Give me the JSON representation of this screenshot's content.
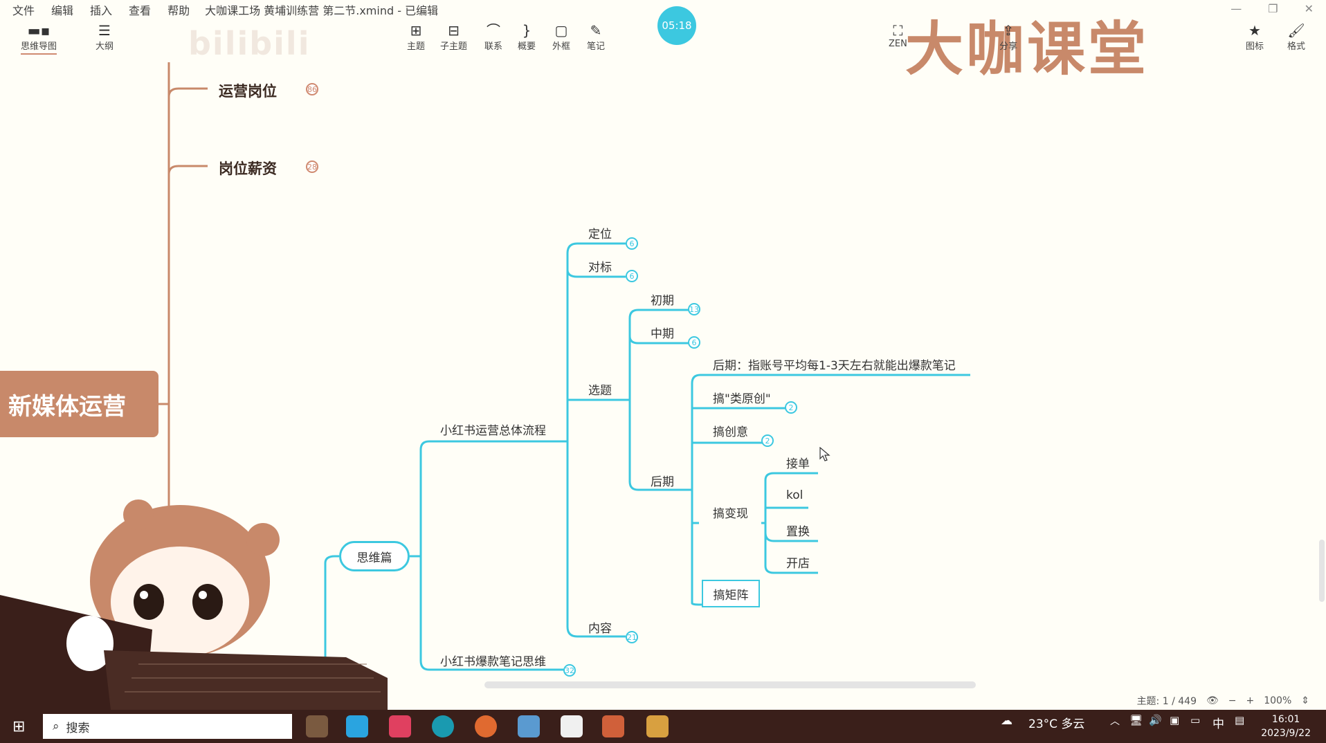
{
  "menu": [
    "文件",
    "编辑",
    "插入",
    "查看",
    "帮助"
  ],
  "window_title": "大咖课工场 黄埔训练营 第二节.xmind - 已编辑",
  "timer": "05:18",
  "brand": "大咖课堂",
  "toolbar": {
    "left": [
      {
        "label": "思维导图",
        "icon": "mindmap-icon"
      },
      {
        "label": "大纲",
        "icon": "outline-icon"
      }
    ],
    "center": [
      {
        "label": "主题",
        "icon": "topic-icon"
      },
      {
        "label": "子主题",
        "icon": "subtopic-icon"
      },
      {
        "label": "联系",
        "icon": "relationship-icon"
      },
      {
        "label": "概要",
        "icon": "summary-icon"
      },
      {
        "label": "外框",
        "icon": "boundary-icon"
      },
      {
        "label": "笔记",
        "icon": "note-icon"
      }
    ],
    "zen": "ZEN",
    "share": "分享",
    "right": [
      {
        "label": "图标",
        "icon": "star-icon"
      },
      {
        "label": "格式",
        "icon": "brush-icon"
      }
    ]
  },
  "watermark": "bilibili",
  "map": {
    "root": "新媒体运营",
    "branches_top": [
      {
        "label": "运营岗位",
        "count": "86"
      },
      {
        "label": "岗位薪资",
        "count": "28"
      }
    ],
    "thinking": "思维篇",
    "process": "小红书运营总体流程",
    "viral": {
      "label": "小红书爆款笔记思维",
      "count": "32"
    },
    "positioning": {
      "label": "定位",
      "count": "6"
    },
    "benchmark": {
      "label": "对标",
      "count": "6"
    },
    "topic_select": "选题",
    "early": {
      "label": "初期",
      "count": "13"
    },
    "middle": {
      "label": "中期",
      "count": "6"
    },
    "late": "后期",
    "late_desc": "后期：指账号平均每1-3天左右就能出爆款笔记",
    "semi_original": {
      "label": "搞\"类原创\"",
      "count": "2"
    },
    "creative": {
      "label": "搞创意",
      "count": "2"
    },
    "monetize": "搞变现",
    "monetize_items": [
      "接单",
      "kol",
      "置换",
      "开店"
    ],
    "matrix": "搞矩阵",
    "content": {
      "label": "内容",
      "count": "21"
    }
  },
  "status": {
    "topics": "主题: 1 / 449",
    "zoom": "100%"
  },
  "taskbar": {
    "search": "搜索",
    "weather": "23°C 多云",
    "ime": "中",
    "time": "16:01",
    "date": "2023/9/22"
  },
  "colors": {
    "accent": "#3cc8e0",
    "root": "#c8896a",
    "taskbar": "#3a1f1a"
  }
}
